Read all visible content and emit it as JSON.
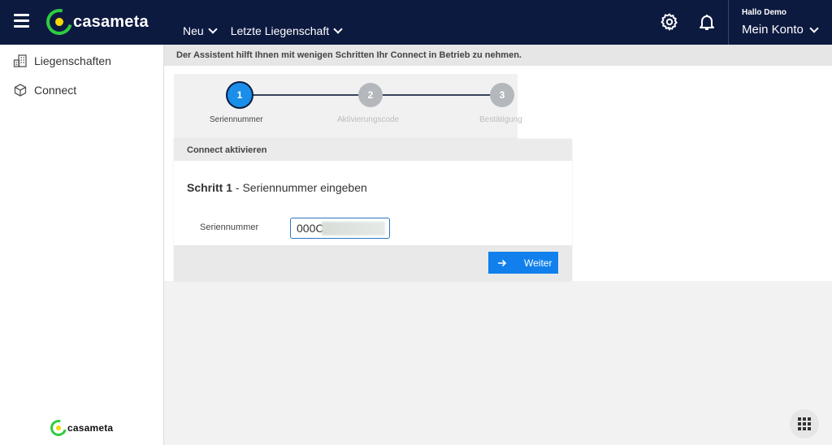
{
  "app": {
    "brand": "casameta"
  },
  "topbar": {
    "nav": [
      {
        "label": "Neu"
      },
      {
        "label": "Letzte Liegenschaft"
      }
    ],
    "account": {
      "greeting": "Hallo Demo",
      "label": "Mein Konto"
    }
  },
  "sidebar": {
    "items": [
      {
        "label": "Liegenschaften",
        "icon": "buildings-icon"
      },
      {
        "label": "Connect",
        "icon": "box-icon"
      }
    ],
    "footer_brand": "casameta"
  },
  "banner": {
    "text": "Der Assistent hilft Ihnen mit wenigen Schritten Ihr Connect in Betrieb zu nehmen."
  },
  "stepper": {
    "steps": [
      {
        "number": "1",
        "label": "Seriennummer",
        "state": "active"
      },
      {
        "number": "2",
        "label": "Aktivierungscode",
        "state": "inactive"
      },
      {
        "number": "3",
        "label": "Bestätigung",
        "state": "inactive"
      }
    ]
  },
  "card": {
    "header": "Connect aktivieren",
    "step_title": "Schritt 1",
    "step_subtitle": " - Seriennummer eingeben",
    "field_label": "Seriennummer",
    "field_value": "000C",
    "button_label": "Weiter"
  },
  "colors": {
    "topbar": "#0d1a40",
    "accent": "#1180ec",
    "brand_green": "#2ecc40",
    "brand_yellow": "#f5d800"
  }
}
